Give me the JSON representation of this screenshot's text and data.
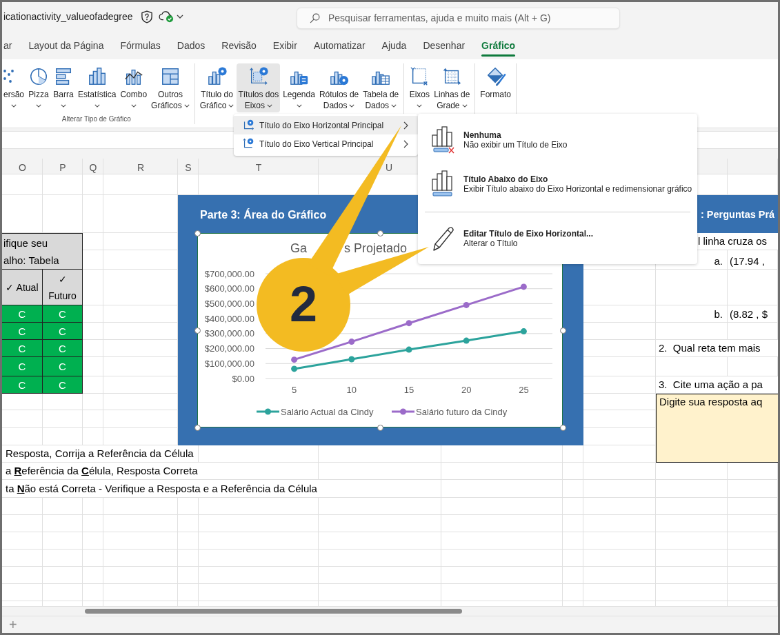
{
  "title_bar": {
    "document_title": "icationactivity_valueofadegree",
    "search": {
      "placeholder": "Pesquisar ferramentas, ajuda e muito mais (Alt + G)"
    }
  },
  "tabs": [
    {
      "label": "ar",
      "selected": false
    },
    {
      "label": "Layout da Página",
      "selected": false
    },
    {
      "label": "Fórmulas",
      "selected": false
    },
    {
      "label": "Dados",
      "selected": false
    },
    {
      "label": "Revisão",
      "selected": false
    },
    {
      "label": "Exibir",
      "selected": false
    },
    {
      "label": "Automatizar",
      "selected": false
    },
    {
      "label": "Ajuda",
      "selected": false
    },
    {
      "label": "Desenhar",
      "selected": false
    },
    {
      "label": "Gráfico",
      "selected": true
    }
  ],
  "ribbon": {
    "groups": [
      {
        "label": "Alterar Tipo de Gráfico",
        "buttons": [
          {
            "label": "ersão",
            "dropdown": true,
            "selected": false
          },
          {
            "label": "Pizza",
            "dropdown": true,
            "selected": false
          },
          {
            "label": "Barra",
            "dropdown": true,
            "selected": false
          },
          {
            "label": "Estatística",
            "dropdown": true,
            "selected": false
          },
          {
            "label": "Combo",
            "dropdown": true,
            "selected": false
          },
          {
            "label": "Outros Gráficos",
            "dropdown": true,
            "selected": false
          }
        ]
      },
      {
        "buttons": [
          {
            "label": "Título do Gráfico",
            "dropdown": true,
            "selected": false
          },
          {
            "label": "Títulos dos Eixos",
            "dropdown": true,
            "selected": true
          },
          {
            "label": "Legenda",
            "dropdown": true,
            "selected": false
          },
          {
            "label": "Rótulos de Dados",
            "dropdown": true,
            "selected": false
          },
          {
            "label": "Tabela de Dados",
            "dropdown": true,
            "selected": false
          }
        ]
      },
      {
        "buttons": [
          {
            "label": "Eixos",
            "dropdown": true,
            "selected": false
          },
          {
            "label": "Linhas de Grade",
            "dropdown": true,
            "selected": false
          }
        ]
      },
      {
        "buttons": [
          {
            "label": "Formato",
            "dropdown": false,
            "selected": false
          }
        ]
      }
    ]
  },
  "axis_titles_menu": {
    "items": [
      {
        "label": "Título do Eixo Horizontal Principal",
        "selected": true
      },
      {
        "label": "Título do Eixo Vertical Principal",
        "selected": false
      }
    ]
  },
  "axis_title_submenu": {
    "items": [
      {
        "kind": "option",
        "title": "Nenhuma",
        "description": "Não exibir um Título de Eixo"
      },
      {
        "kind": "option",
        "title": "Título Abaixo do Eixo",
        "description": "Exibir Título abaixo do Eixo Horizontal e redimensionar gráfico"
      },
      {
        "kind": "separator"
      },
      {
        "kind": "action",
        "title": "Editar Título de Eixo Horizontal...",
        "description": "Alterar o Título"
      }
    ]
  },
  "sheet": {
    "column_headers": [
      "O",
      "P",
      "Q",
      "R",
      "S",
      "T",
      "U"
    ],
    "check_table": {
      "title_lines": [
        "ifique seu",
        "alho: Tabela"
      ],
      "headers": [
        "✓ Atual",
        "✓ Futuro"
      ],
      "rows": [
        [
          "C",
          "C"
        ],
        [
          "C",
          "C"
        ],
        [
          "C",
          "C"
        ],
        [
          "C",
          "C"
        ],
        [
          "C",
          "C"
        ]
      ]
    },
    "chart_panel": {
      "title": "Parte 3: Área do Gráfico",
      "chart_title_parts": [
        "Ga",
        "s Projetado"
      ],
      "chart_data": {
        "type": "line",
        "x": [
          5,
          10,
          15,
          20,
          25
        ],
        "xlim": [
          2.5,
          27.5
        ],
        "xticks": [
          5,
          10,
          15,
          20,
          25
        ],
        "ylim": [
          0,
          700000
        ],
        "yticks": [
          {
            "value": 0,
            "label": "$0.00"
          },
          {
            "value": 100000,
            "label": "$100,000.00"
          },
          {
            "value": 200000,
            "label": "$200,000.00"
          },
          {
            "value": 300000,
            "label": "$300,000.00"
          },
          {
            "value": 400000,
            "label": "$400,000.00"
          },
          {
            "value": 500000,
            "label": "$500,000.00"
          },
          {
            "value": 600000,
            "label": "$600,000.00"
          },
          {
            "value": 700000,
            "label": "$700,000.00"
          }
        ],
        "grid": true,
        "legend": "bottom",
        "series": [
          {
            "name": "Salário Actual da Cindy",
            "color": "#2ca39c",
            "marker": "circle",
            "values": [
              65000,
              129000,
              193000,
              253000,
              315000
            ]
          },
          {
            "name": "Salário futuro da Cindy",
            "color": "#9b6bc9",
            "marker": "circle",
            "values": [
              126000,
              246000,
              370000,
              491000,
              613000
            ]
          }
        ]
      }
    },
    "questions_panel": {
      "title": ": Perguntas Prá",
      "lines": [
        {
          "kind": "fragment",
          "text": "l linha cruza os"
        },
        {
          "kind": "option",
          "label": "a.",
          "text": "(17.94 ,"
        },
        {
          "kind": "option",
          "label": "b.",
          "text": "(8.82 , $"
        },
        {
          "kind": "question",
          "text": "2.  Qual reta tem mais"
        },
        {
          "kind": "question",
          "text": "3.  Cite uma ação a pa"
        }
      ],
      "answer_box": "Digite sua resposta aq"
    },
    "key_lines": [
      "Resposta, Corrija a Referência da Célula",
      "a **R**eferência da **C**élula, Resposta Correta",
      "ta **N**ão está Correta - Verifique a Resposta e a Referência da Célula"
    ]
  },
  "callout": {
    "number": "2"
  },
  "sheet_tabs": {
    "add_button": "+"
  }
}
